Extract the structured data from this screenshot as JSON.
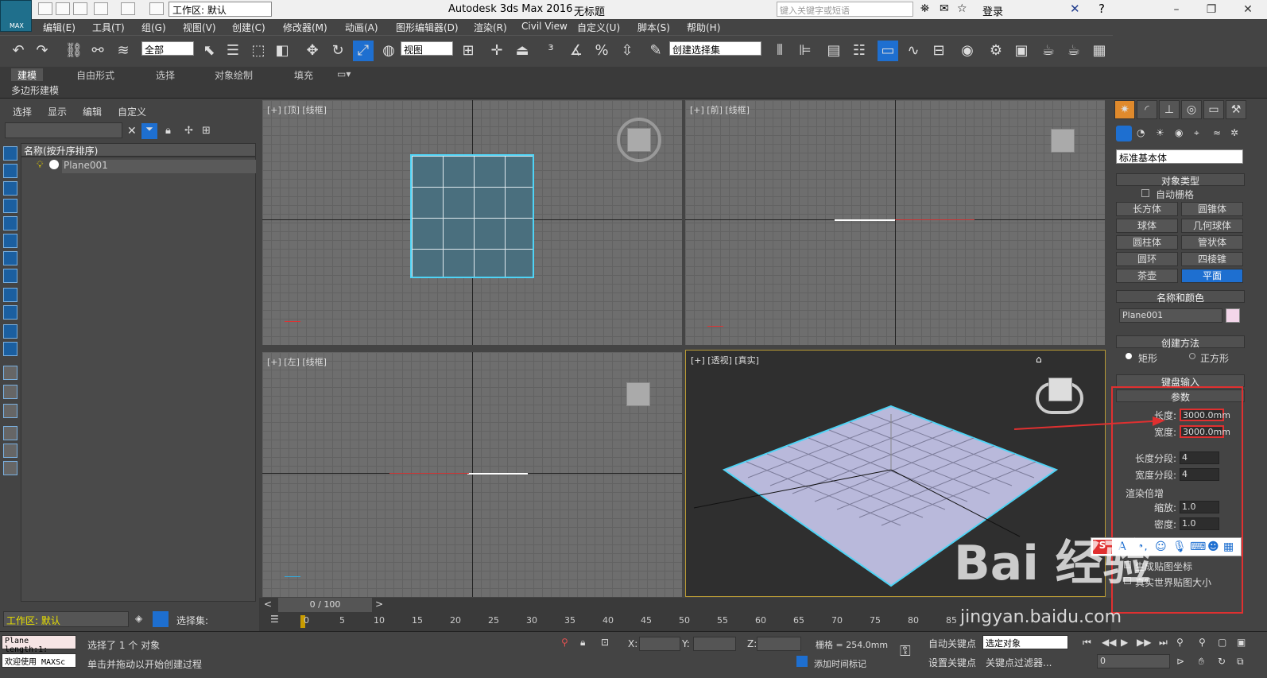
{
  "window": {
    "app_title": "Autodesk 3ds Max 2016",
    "doc_title": "无标题",
    "logo_text": "MAX",
    "workspace": "工作区: 默认",
    "search_placeholder": "键入关键字或短语",
    "login": "登录"
  },
  "menus": [
    "编辑(E)",
    "工具(T)",
    "组(G)",
    "视图(V)",
    "创建(C)",
    "修改器(M)",
    "动画(A)",
    "图形编辑器(D)",
    "渲染(R)",
    "Civil View",
    "自定义(U)",
    "脚本(S)",
    "帮助(H)"
  ],
  "toolbar": {
    "filter_select": "全部",
    "ref_coord": "视图",
    "named_sel": "创建选择集"
  },
  "ribbon": {
    "tabs": [
      "建模",
      "自由形式",
      "选择",
      "对象绘制",
      "填充"
    ],
    "sub_label": "多边形建模"
  },
  "scene_explorer": {
    "menu": [
      "选择",
      "显示",
      "编辑",
      "自定义"
    ],
    "header": "名称(按升序排序)",
    "items": [
      "Plane001"
    ],
    "workspace": "工作区: 默认",
    "selection_set_label": "选择集:"
  },
  "viewports": {
    "top": "[+] [顶] [线框]",
    "front": "[+] [前] [线框]",
    "left": "[+] [左] [线框]",
    "persp": "[+] [透视] [真实]"
  },
  "command_panel": {
    "category": "标准基本体",
    "object_type_title": "对象类型",
    "autogrid": "自动栅格",
    "object_buttons": [
      "长方体",
      "圆锥体",
      "球体",
      "几何球体",
      "圆柱体",
      "管状体",
      "圆环",
      "四棱锥",
      "茶壶",
      "平面"
    ],
    "active_button": "平面",
    "name_color_title": "名称和颜色",
    "object_name": "Plane001",
    "object_color": "#f3d6ea",
    "creation_title": "创建方法",
    "creation_options": [
      "矩形",
      "正方形"
    ],
    "keyboard_title": "键盘输入",
    "params_title": "参数",
    "length_label": "长度:",
    "length_value": "3000.0mm",
    "width_label": "宽度:",
    "width_value": "3000.0mm",
    "length_segs_label": "长度分段:",
    "length_segs": "4",
    "width_segs_label": "宽度分段:",
    "width_segs": "4",
    "render_mult_title": "渲染倍增",
    "scale_label": "缩放:",
    "scale_value": "1.0",
    "density_label": "密度:",
    "density_value": "1.0",
    "gen_map_coords": "生成贴图坐标",
    "real_world_map": "真实世界贴图大小"
  },
  "timeline": {
    "frame_display": "0 / 100",
    "ticks": [
      "0",
      "5",
      "10",
      "15",
      "20",
      "25",
      "30",
      "35",
      "40",
      "45",
      "50",
      "55",
      "60",
      "65",
      "70",
      "75",
      "80",
      "85"
    ]
  },
  "status": {
    "maxscript1": "Plane length:1:",
    "maxscript2": "欢迎使用 MAXSc",
    "selected": "选择了 1 个 对象",
    "prompt": "单击并拖动以开始创建过程",
    "x_label": "X:",
    "y_label": "Y:",
    "z_label": "Z:",
    "grid": "栅格 = 254.0mm",
    "add_time_tag": "添加时间标记",
    "auto_key": "自动关键点",
    "set_key": "设置关键点",
    "selected_obj": "选定对象",
    "key_filters": "关键点过滤器...",
    "frame_value": "0"
  },
  "watermark": {
    "brand": "Bai 经验",
    "url": "jingyan.baidu.com"
  },
  "colors": {
    "selection": "#4fd3f5",
    "highlight_box": "#e03030",
    "active_blue": "#1e6fd0"
  }
}
